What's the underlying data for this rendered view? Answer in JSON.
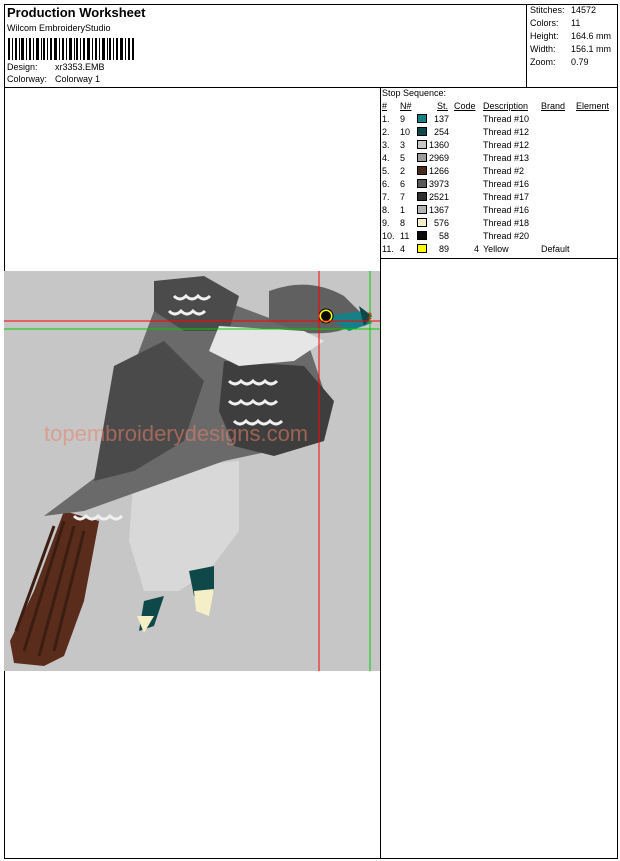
{
  "header": {
    "title": "Production Worksheet",
    "vendor": "Wilcom EmbroideryStudio",
    "design_label": "Design:",
    "design_value": "xr3353.EMB",
    "colorway_label": "Colorway:",
    "colorway_value": "Colorway 1"
  },
  "stats": [
    {
      "label": "Stitches:",
      "value": "14572"
    },
    {
      "label": "Colors:",
      "value": "11"
    },
    {
      "label": "Height:",
      "value": "164.6 mm"
    },
    {
      "label": "Width:",
      "value": "156.1 mm"
    },
    {
      "label": "Zoom:",
      "value": "0.79"
    }
  ],
  "watermark": "topembroiderydesigns.com",
  "stop_sequence": {
    "title": "Stop Sequence:",
    "columns": {
      "num": "#",
      "n_num": "N#",
      "st": "St.",
      "code": "Code",
      "description": "Description",
      "brand": "Brand",
      "element": "Element"
    },
    "rows": [
      {
        "num": "1.",
        "n": "9",
        "color": "#177f86",
        "st": "137",
        "code": "",
        "desc": "Thread #10",
        "brand": ""
      },
      {
        "num": "2.",
        "n": "10",
        "color": "#0f4848",
        "st": "254",
        "code": "",
        "desc": "Thread #12",
        "brand": ""
      },
      {
        "num": "3.",
        "n": "3",
        "color": "#c7c7c7",
        "st": "1360",
        "code": "",
        "desc": "Thread #12",
        "brand": ""
      },
      {
        "num": "4.",
        "n": "5",
        "color": "#9c9c9c",
        "st": "2969",
        "code": "",
        "desc": "Thread #13",
        "brand": ""
      },
      {
        "num": "5.",
        "n": "2",
        "color": "#4a2a1a",
        "st": "1266",
        "code": "",
        "desc": "Thread #2",
        "brand": ""
      },
      {
        "num": "6.",
        "n": "6",
        "color": "#5a5a5a",
        "st": "3973",
        "code": "",
        "desc": "Thread #16",
        "brand": ""
      },
      {
        "num": "7.",
        "n": "7",
        "color": "#2f2f2f",
        "st": "2521",
        "code": "",
        "desc": "Thread #17",
        "brand": ""
      },
      {
        "num": "8.",
        "n": "1",
        "color": "#b4b4b4",
        "st": "1367",
        "code": "",
        "desc": "Thread #16",
        "brand": ""
      },
      {
        "num": "9.",
        "n": "8",
        "color": "#f5efc7",
        "st": "576",
        "code": "",
        "desc": "Thread #18",
        "brand": ""
      },
      {
        "num": "10.",
        "n": "11",
        "color": "#0a0a0a",
        "st": "58",
        "code": "",
        "desc": "Thread #20",
        "brand": ""
      },
      {
        "num": "11.",
        "n": "4",
        "color": "#ffff00",
        "st": "89",
        "code": "4",
        "desc": "Yellow",
        "brand": "Default"
      }
    ]
  }
}
